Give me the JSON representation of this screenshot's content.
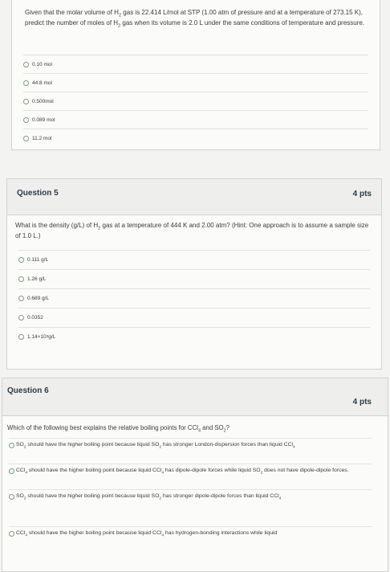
{
  "q4": {
    "text_a": "Given that the molar volume of H",
    "h2": "2",
    "text_b": " gas is 22.414 L/mol at STP (1.00 atm of pressure and at a temperature of 273.15 K), predict the number of moles of H",
    "text_c": " gas when its volume is 2.0 L under the same conditions of temperature and pressure.",
    "answers": [
      "0.10 mol",
      "44.8 mol",
      "0.500mol",
      "0.089 mol",
      "11.2 mol"
    ]
  },
  "q5": {
    "title": "Question 5",
    "points": "4 pts",
    "text_a": "What is the density (g/L) of H",
    "h2": "2",
    "text_b": " gas at a temperature of 444 K and 2.00 atm? (Hint: One approach is to assume a sample size of 1.0 L.)",
    "answers": [
      "0.111 g/L",
      "1.26 g/L",
      "0.689 g/L",
      "0.0352"
    ],
    "answer5_base": "1.14×10",
    "answer5_exp": "3",
    "answer5_unit": " g/L"
  },
  "q6": {
    "title": "Question 6",
    "points": "4 pts",
    "text_a": "Which of the following best explains the relative boiling points for CCl",
    "sub4": "4",
    "text_b": " and SO",
    "sub2": "2",
    "text_c": "?",
    "answers": [
      {
        "a": "SO",
        "s1": "2",
        "b": " should have the higher boiling point because liquid SO",
        "s2": "2",
        "c": " has stronger London-dispersion forces than liquid CCl",
        "s3": "4",
        "d": ""
      },
      {
        "a": "CCl",
        "s1": "4",
        "b": " should have the higher boiling point because liquid CCl",
        "s2": "4",
        "c": " has dipole-dipole forces while liquid SO",
        "s3": "2",
        "d": " does not have dipole-dipole forces."
      },
      {
        "a": "SO",
        "s1": "2",
        "b": " should have the higher boiling point because liquid SO",
        "s2": "2",
        "c": " has stronger dipole-dipole forces than liquid CCl",
        "s3": "4",
        "d": ""
      },
      {
        "a": "CCl",
        "s1": "4",
        "b": " should have the higher boiling point because liquid CCl",
        "s2": "4",
        "c": " has hydrogen-bonding interactions while liquid",
        "s3": "",
        "d": ""
      }
    ]
  }
}
